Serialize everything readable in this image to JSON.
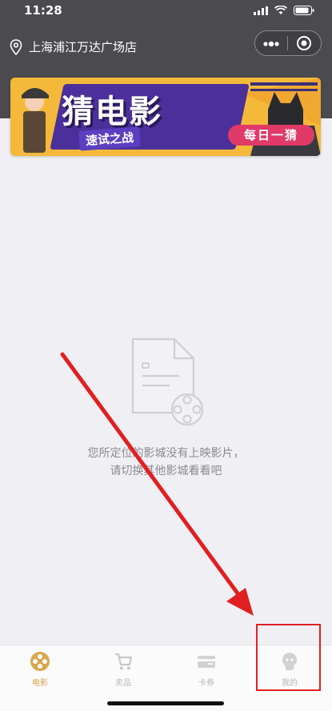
{
  "status": {
    "time": "11:28"
  },
  "header": {
    "location": "上海浦江万达广场店"
  },
  "banner": {
    "title": "猜电影",
    "subtitle": "速试之战",
    "badge": "每日一猜"
  },
  "empty": {
    "line1": "您所定位的影城没有上映影片，",
    "line2": "请切换其他影城看看吧"
  },
  "tabs": [
    {
      "label": "电影",
      "icon": "film-reel-icon",
      "active": true
    },
    {
      "label": "卖品",
      "icon": "cart-icon",
      "active": false
    },
    {
      "label": "卡券",
      "icon": "card-icon",
      "active": false
    },
    {
      "label": "我的",
      "icon": "user-icon",
      "active": false
    }
  ],
  "colors": {
    "accent": "#d4a04a",
    "header": "#4a4a4f",
    "annotation": "#e02020"
  }
}
